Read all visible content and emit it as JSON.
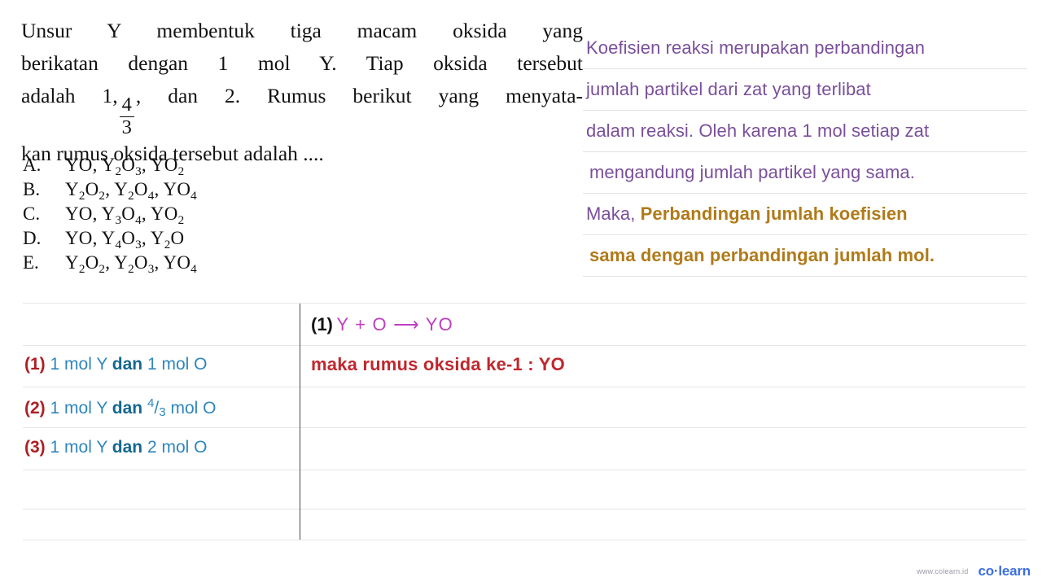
{
  "question": {
    "lines": [
      "Unsur Y membentuk tiga macam oksida yang",
      "berikatan dengan 1 mol Y. Tiap oksida tersebut"
    ],
    "line3_before": "adalah 1,",
    "fraction": {
      "numerator": "4",
      "denominator": "3"
    },
    "line3_after": ", dan 2. Rumus berikut yang menyata-",
    "line4": "kan rumus oksida tersebut adalah ...."
  },
  "options": [
    {
      "letter": "A.",
      "formula": "YO, Y2O3, YO2"
    },
    {
      "letter": "B.",
      "formula": "Y2O2, Y2O4, YO4"
    },
    {
      "letter": "C.",
      "formula": "YO, Y3O4, YO2"
    },
    {
      "letter": "D.",
      "formula": "YO, Y4O3, Y2O"
    },
    {
      "letter": "E.",
      "formula": "Y2O2, Y2O3, YO4"
    }
  ],
  "explanation": {
    "lines": [
      "Koefisien reaksi merupakan perbandingan",
      "jumlah partikel dari zat yang terlibat",
      "dalam reaksi. Oleh karena 1 mol setiap zat",
      "mengandung jumlah partikel yang sama."
    ],
    "line5_normal": "Maka,",
    "line5_bold": "Perbandingan jumlah koefisien",
    "line6_bold": "sama dengan perbandingan jumlah mol."
  },
  "work_table": {
    "left_rows": [
      {
        "index": "(1)",
        "mol_y": "1 mol Y",
        "dan": "dan",
        "mol_o": "1 mol O",
        "fraction": null
      },
      {
        "index": "(2)",
        "mol_y": "1 mol Y",
        "dan": "dan",
        "mol_o": "mol O",
        "fraction": {
          "numerator": "4",
          "denominator": "3"
        }
      },
      {
        "index": "(3)",
        "mol_y": "1 mol Y",
        "dan": "dan",
        "mol_o": "2 mol O",
        "fraction": null
      }
    ],
    "reaction": {
      "index": "(1)",
      "equation": "Y + O ⟶ YO"
    },
    "conclusion": "maka rumus oksida ke-1 : YO"
  },
  "footer": {
    "url": "www.colearn.id",
    "logo": "co·learn"
  },
  "colors": {
    "purple": "#7a4f9b",
    "gold": "#b07a19",
    "red": "#ad1f22",
    "blue": "#2f86bd",
    "magenta": "#c03ec0",
    "conclusion_red": "#c0272d",
    "logo_blue": "#3c6fe2"
  }
}
